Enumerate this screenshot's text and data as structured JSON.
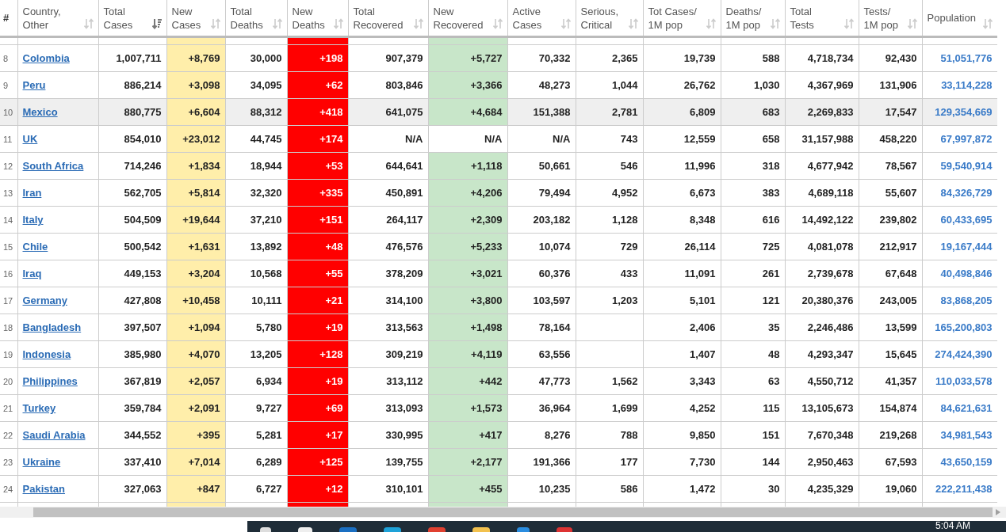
{
  "table": {
    "columns": [
      {
        "label": "#",
        "kind": "rank",
        "sorted": false
      },
      {
        "label": "Country,\nOther",
        "kind": "country",
        "sorted": false
      },
      {
        "label": "Total\nCases",
        "kind": "plain",
        "sorted": true
      },
      {
        "label": "New\nCases",
        "kind": "new_cases",
        "sorted": false
      },
      {
        "label": "Total\nDeaths",
        "kind": "plain",
        "sorted": false
      },
      {
        "label": "New\nDeaths",
        "kind": "new_deaths",
        "sorted": false
      },
      {
        "label": "Total\nRecovered",
        "kind": "plain",
        "sorted": false
      },
      {
        "label": "New\nRecovered",
        "kind": "new_recovered",
        "sorted": false
      },
      {
        "label": "Active\nCases",
        "kind": "plain",
        "sorted": false
      },
      {
        "label": "Serious,\nCritical",
        "kind": "plain",
        "sorted": false
      },
      {
        "label": "Tot Cases/\n1M pop",
        "kind": "plain",
        "sorted": false
      },
      {
        "label": "Deaths/\n1M pop",
        "kind": "plain",
        "sorted": false
      },
      {
        "label": "Total\nTests",
        "kind": "plain",
        "sorted": false
      },
      {
        "label": "Tests/\n1M pop",
        "kind": "plain",
        "sorted": false
      },
      {
        "label": "Population",
        "kind": "population",
        "sorted": false
      }
    ],
    "rows": [
      {
        "highlighted": false,
        "recovered_reported": true,
        "cells": [
          "8",
          "Colombia",
          "1,007,711",
          "+8,769",
          "30,000",
          "+198",
          "907,379",
          "+5,727",
          "70,332",
          "2,365",
          "19,739",
          "588",
          "4,718,734",
          "92,430",
          "51,051,776"
        ]
      },
      {
        "highlighted": false,
        "recovered_reported": true,
        "cells": [
          "9",
          "Peru",
          "886,214",
          "+3,098",
          "34,095",
          "+62",
          "803,846",
          "+3,366",
          "48,273",
          "1,044",
          "26,762",
          "1,030",
          "4,367,969",
          "131,906",
          "33,114,228"
        ]
      },
      {
        "highlighted": true,
        "recovered_reported": true,
        "cells": [
          "10",
          "Mexico",
          "880,775",
          "+6,604",
          "88,312",
          "+418",
          "641,075",
          "+4,684",
          "151,388",
          "2,781",
          "6,809",
          "683",
          "2,269,833",
          "17,547",
          "129,354,669"
        ]
      },
      {
        "highlighted": false,
        "recovered_reported": false,
        "cells": [
          "11",
          "UK",
          "854,010",
          "+23,012",
          "44,745",
          "+174",
          "N/A",
          "N/A",
          "N/A",
          "743",
          "12,559",
          "658",
          "31,157,988",
          "458,220",
          "67,997,872"
        ]
      },
      {
        "highlighted": false,
        "recovered_reported": true,
        "cells": [
          "12",
          "South Africa",
          "714,246",
          "+1,834",
          "18,944",
          "+53",
          "644,641",
          "+1,118",
          "50,661",
          "546",
          "11,996",
          "318",
          "4,677,942",
          "78,567",
          "59,540,914"
        ]
      },
      {
        "highlighted": false,
        "recovered_reported": true,
        "cells": [
          "13",
          "Iran",
          "562,705",
          "+5,814",
          "32,320",
          "+335",
          "450,891",
          "+4,206",
          "79,494",
          "4,952",
          "6,673",
          "383",
          "4,689,118",
          "55,607",
          "84,326,729"
        ]
      },
      {
        "highlighted": false,
        "recovered_reported": true,
        "cells": [
          "14",
          "Italy",
          "504,509",
          "+19,644",
          "37,210",
          "+151",
          "264,117",
          "+2,309",
          "203,182",
          "1,128",
          "8,348",
          "616",
          "14,492,122",
          "239,802",
          "60,433,695"
        ]
      },
      {
        "highlighted": false,
        "recovered_reported": true,
        "cells": [
          "15",
          "Chile",
          "500,542",
          "+1,631",
          "13,892",
          "+48",
          "476,576",
          "+5,233",
          "10,074",
          "729",
          "26,114",
          "725",
          "4,081,078",
          "212,917",
          "19,167,444"
        ]
      },
      {
        "highlighted": false,
        "recovered_reported": true,
        "cells": [
          "16",
          "Iraq",
          "449,153",
          "+3,204",
          "10,568",
          "+55",
          "378,209",
          "+3,021",
          "60,376",
          "433",
          "11,091",
          "261",
          "2,739,678",
          "67,648",
          "40,498,846"
        ]
      },
      {
        "highlighted": false,
        "recovered_reported": true,
        "cells": [
          "17",
          "Germany",
          "427,808",
          "+10,458",
          "10,111",
          "+21",
          "314,100",
          "+3,800",
          "103,597",
          "1,203",
          "5,101",
          "121",
          "20,380,376",
          "243,005",
          "83,868,205"
        ]
      },
      {
        "highlighted": false,
        "recovered_reported": true,
        "cells": [
          "18",
          "Bangladesh",
          "397,507",
          "+1,094",
          "5,780",
          "+19",
          "313,563",
          "+1,498",
          "78,164",
          null,
          "2,406",
          "35",
          "2,246,486",
          "13,599",
          "165,200,803"
        ]
      },
      {
        "highlighted": false,
        "recovered_reported": true,
        "cells": [
          "19",
          "Indonesia",
          "385,980",
          "+4,070",
          "13,205",
          "+128",
          "309,219",
          "+4,119",
          "63,556",
          null,
          "1,407",
          "48",
          "4,293,347",
          "15,645",
          "274,424,390"
        ]
      },
      {
        "highlighted": false,
        "recovered_reported": true,
        "cells": [
          "20",
          "Philippines",
          "367,819",
          "+2,057",
          "6,934",
          "+19",
          "313,112",
          "+442",
          "47,773",
          "1,562",
          "3,343",
          "63",
          "4,550,712",
          "41,357",
          "110,033,578"
        ]
      },
      {
        "highlighted": false,
        "recovered_reported": true,
        "cells": [
          "21",
          "Turkey",
          "359,784",
          "+2,091",
          "9,727",
          "+69",
          "313,093",
          "+1,573",
          "36,964",
          "1,699",
          "4,252",
          "115",
          "13,105,673",
          "154,874",
          "84,621,631"
        ]
      },
      {
        "highlighted": false,
        "recovered_reported": true,
        "cells": [
          "22",
          "Saudi Arabia",
          "344,552",
          "+395",
          "5,281",
          "+17",
          "330,995",
          "+417",
          "8,276",
          "788",
          "9,850",
          "151",
          "7,670,348",
          "219,268",
          "34,981,543"
        ]
      },
      {
        "highlighted": false,
        "recovered_reported": true,
        "cells": [
          "23",
          "Ukraine",
          "337,410",
          "+7,014",
          "6,289",
          "+125",
          "139,755",
          "+2,177",
          "191,366",
          "177",
          "7,730",
          "144",
          "2,950,463",
          "67,593",
          "43,650,159"
        ]
      },
      {
        "highlighted": false,
        "recovered_reported": true,
        "cells": [
          "24",
          "Pakistan",
          "327,063",
          "+847",
          "6,727",
          "+12",
          "310,101",
          "+455",
          "10,235",
          "586",
          "1,472",
          "30",
          "4,235,329",
          "19,060",
          "222,211,438"
        ]
      }
    ]
  },
  "taskbar": {
    "time": "5:04 AM"
  }
}
